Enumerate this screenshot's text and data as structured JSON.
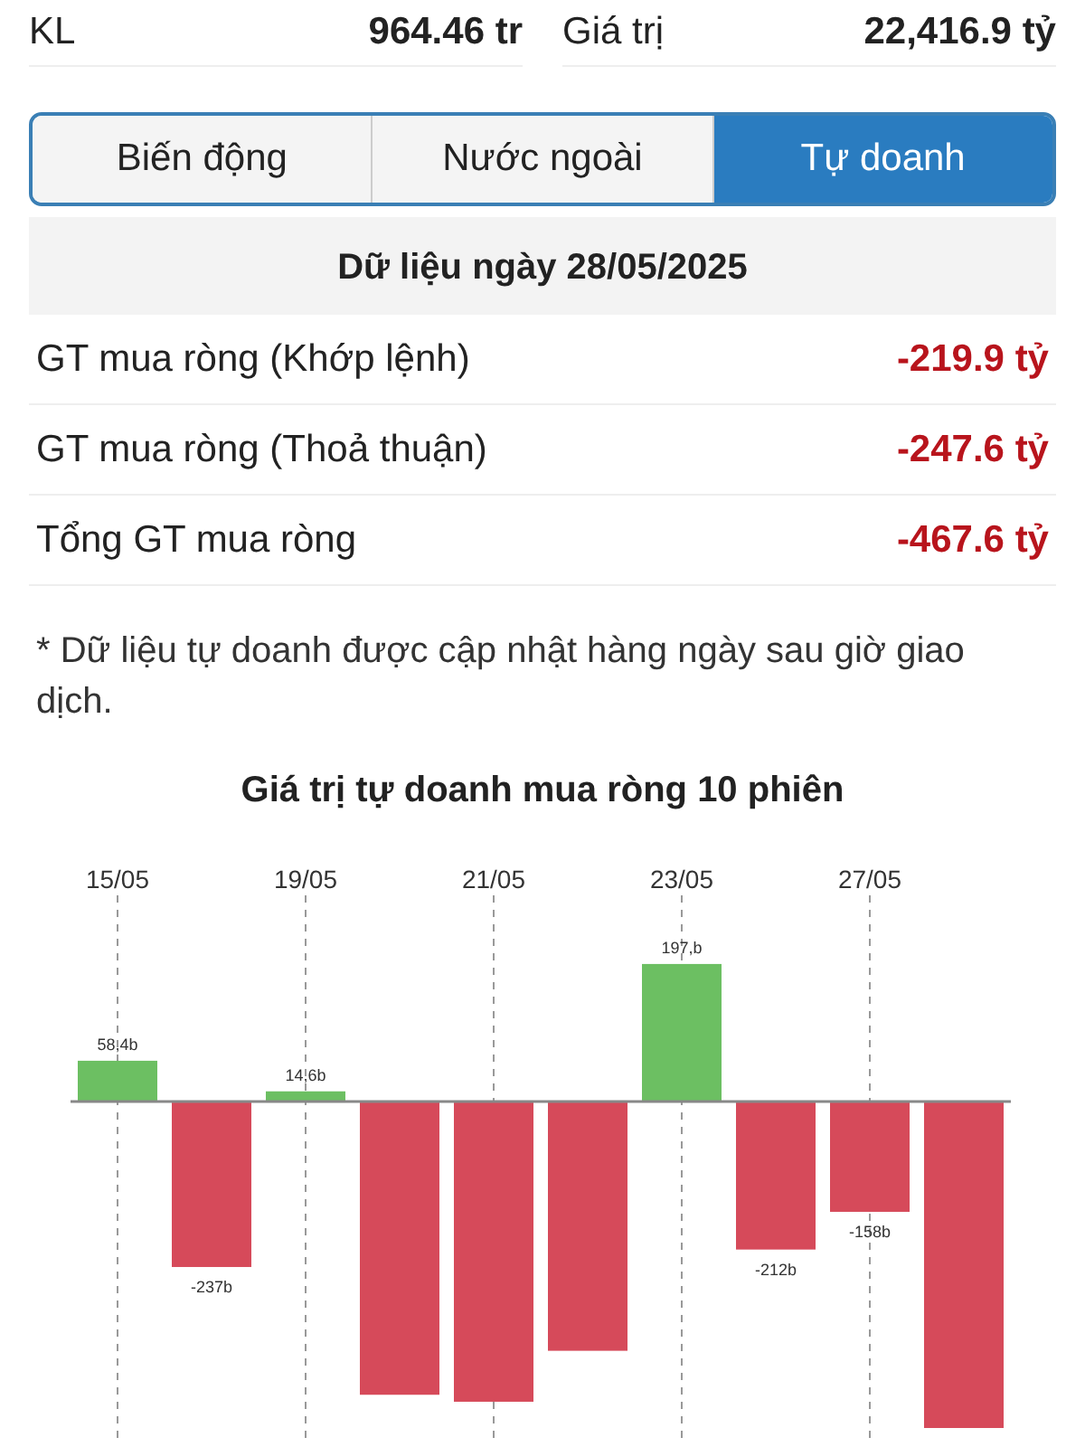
{
  "stats": [
    {
      "label": "KL",
      "value": "964.46 tr"
    },
    {
      "label": "Giá trị",
      "value": "22,416.9 tỷ"
    }
  ],
  "tabs": [
    {
      "label": "Biến động",
      "selected": false
    },
    {
      "label": "Nước ngoài",
      "selected": false
    },
    {
      "label": "Tự doanh",
      "selected": true
    }
  ],
  "summary": {
    "title": "Dữ liệu ngày 28/05/2025",
    "rows": [
      {
        "label": "GT mua ròng (Khớp lệnh)",
        "value": "-219.9 tỷ"
      },
      {
        "label": "GT mua ròng (Thoả thuận)",
        "value": "-247.6 tỷ"
      },
      {
        "label": "Tổng GT mua ròng",
        "value": "-467.6 tỷ"
      }
    ]
  },
  "note": "* Dữ liệu tự doanh được cập nhật hàng ngày sau giờ giao dịch.",
  "chart": {
    "chart_data": {
      "type": "bar",
      "title": "Giá trị tự doanh mua ròng 10 phiên",
      "grid": true,
      "categories": [
        "15/05",
        null,
        "19/05",
        null,
        "21/05",
        null,
        "23/05",
        null,
        "27/05",
        null
      ],
      "series": [
        {
          "color": "#6cbf62",
          "values": [
            58.4,
            null,
            14.6,
            null,
            null,
            null,
            197,
            null,
            null,
            null
          ],
          "value_labels": [
            "58,4b",
            null,
            "14,6b",
            null,
            null,
            null,
            "197,b",
            null,
            null,
            null
          ]
        },
        {
          "color": "#d64a5a",
          "values": [
            null,
            -237,
            null,
            -420,
            -430,
            -357,
            null,
            -212,
            -158,
            -467.6
          ],
          "value_labels": [
            null,
            "-237b",
            null,
            null,
            null,
            null,
            null,
            "-212b",
            "-158b",
            null
          ]
        }
      ]
    }
  }
}
